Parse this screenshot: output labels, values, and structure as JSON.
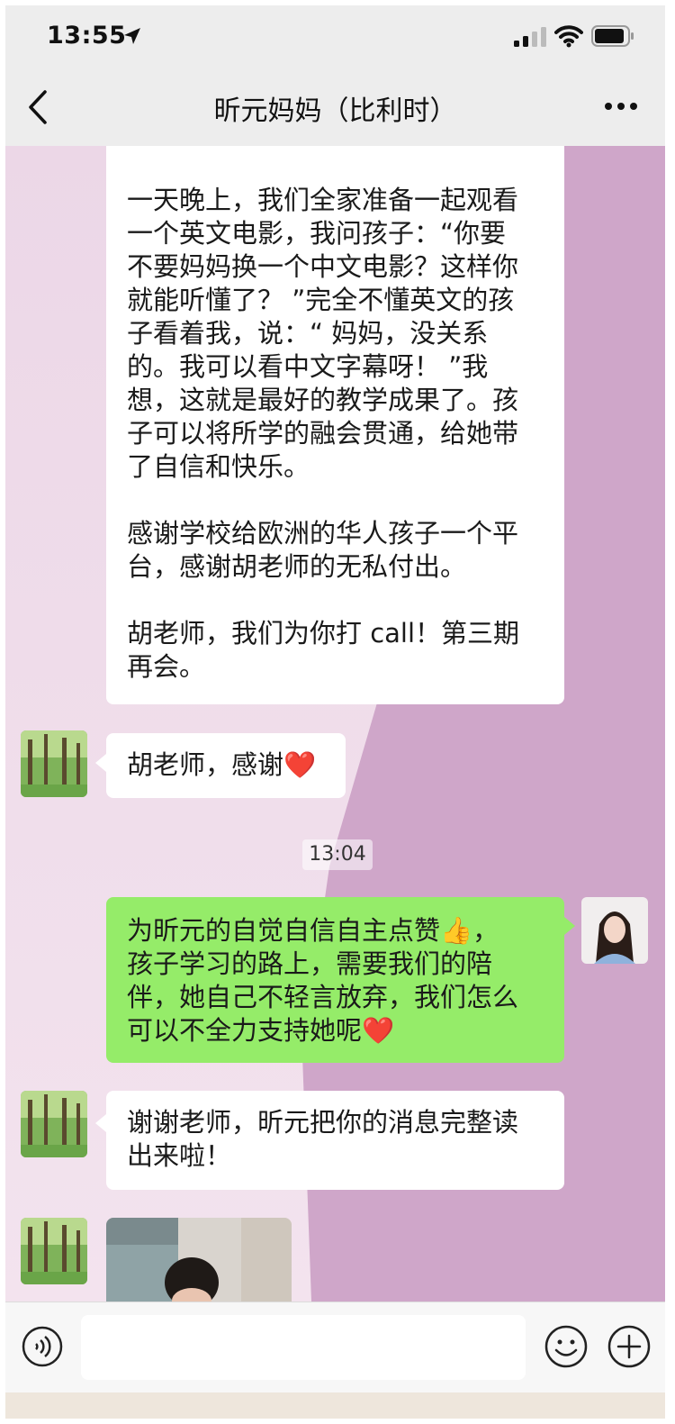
{
  "status_bar": {
    "time": "13:55"
  },
  "header": {
    "title": "昕元妈妈（比利时）"
  },
  "messages": {
    "m1": {
      "paragraphs": [
        "一天晚上，我们全家准备一起观看\n一个英文电影，我问孩子：“你要\n不要妈妈换一个中文电影？这样你\n就能听懂了？ ”完全不懂英文的孩\n子看着我，说：“ 妈妈，没关系\n的。我可以看中文字幕呀！ ”我\n想，这就是最好的教学成果了。孩\n子可以将所学的融会贯通，给她带\n了自信和快乐。",
        "感谢学校给欧洲的华人孩子一个平\n台，感谢胡老师的无私付出。",
        "胡老师，我们为你打 call！第三期\n再会。"
      ]
    },
    "m2": {
      "text": "胡老师，感谢❤️"
    },
    "timestamp": "13:04",
    "m3": {
      "text": "为昕元的自觉自信自主点赞👍，\n孩子学习的路上，需要我们的陪\n伴，她自己不轻言放弃，我们怎么\n可以不全力支持她呢❤️"
    },
    "m4": {
      "text": "谢谢老师，昕元把你的消息完整读\n出来啦！"
    }
  },
  "icons": {
    "location": "location-arrow-icon",
    "signal": "cellular-signal-icon",
    "wifi": "wifi-icon",
    "battery": "battery-icon",
    "back": "back-chevron-icon",
    "more": "more-dots-icon",
    "voice": "voice-icon",
    "emoji": "emoji-icon",
    "plus": "plus-icon"
  },
  "colors": {
    "sent_bubble": "#95ec69",
    "received_bubble": "#ffffff",
    "chat_background": "#cfa6c9",
    "bar_background": "#ededed"
  }
}
